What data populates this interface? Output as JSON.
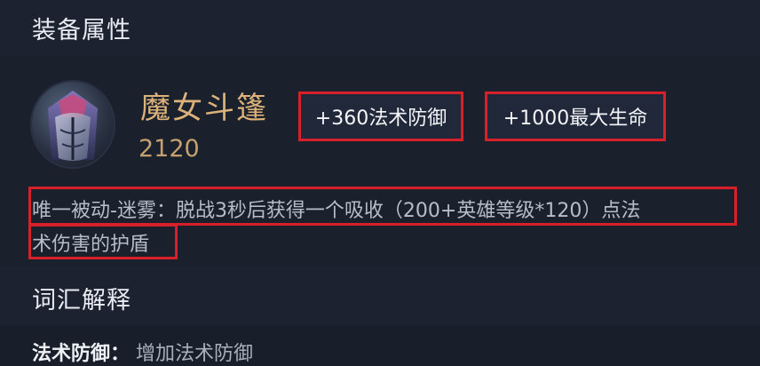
{
  "sections": {
    "attributes_title": "装备属性",
    "glossary_title": "词汇解释"
  },
  "item": {
    "name": "魔女斗篷",
    "price": "2120",
    "icon": "cloak-item-icon",
    "stats": [
      "+360法术防御",
      "+1000最大生命"
    ],
    "passive_lines": [
      "唯一被动-迷雾：脱战3秒后获得一个吸收（200+英雄等级*120）点法",
      "术伤害的护盾"
    ]
  },
  "glossary": [
    {
      "term": "法术防御：",
      "desc": "增加法术防御"
    }
  ],
  "colors": {
    "background": "#181e2a",
    "item_name": "#dcb27a",
    "price": "#c6a170",
    "highlight_border": "#d8202a"
  }
}
